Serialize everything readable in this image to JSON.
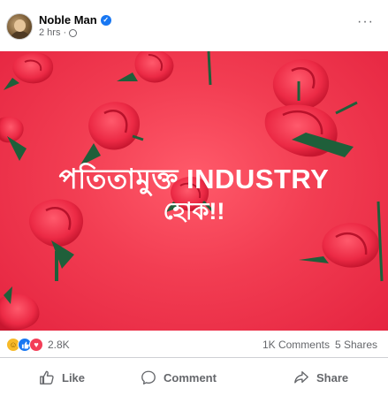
{
  "post": {
    "author": "Noble Man",
    "time": "2 hrs",
    "more_label": "···"
  },
  "image": {
    "headline_line1": "পতিতামুক্ত INDUSTRY",
    "headline_line2": "হোক!!",
    "background_color": "#f23d52"
  },
  "stats": {
    "reaction_count": "2.8K",
    "comments": "1K Comments",
    "shares": "5 Shares",
    "reactions": [
      "haha",
      "like",
      "love"
    ]
  },
  "actions": {
    "like": "Like",
    "comment": "Comment",
    "share": "Share"
  },
  "colors": {
    "accent": "#1877f2",
    "muted_text": "#65676b",
    "rose_red": "#f0314a",
    "leaf_green": "#1f5f3a"
  }
}
